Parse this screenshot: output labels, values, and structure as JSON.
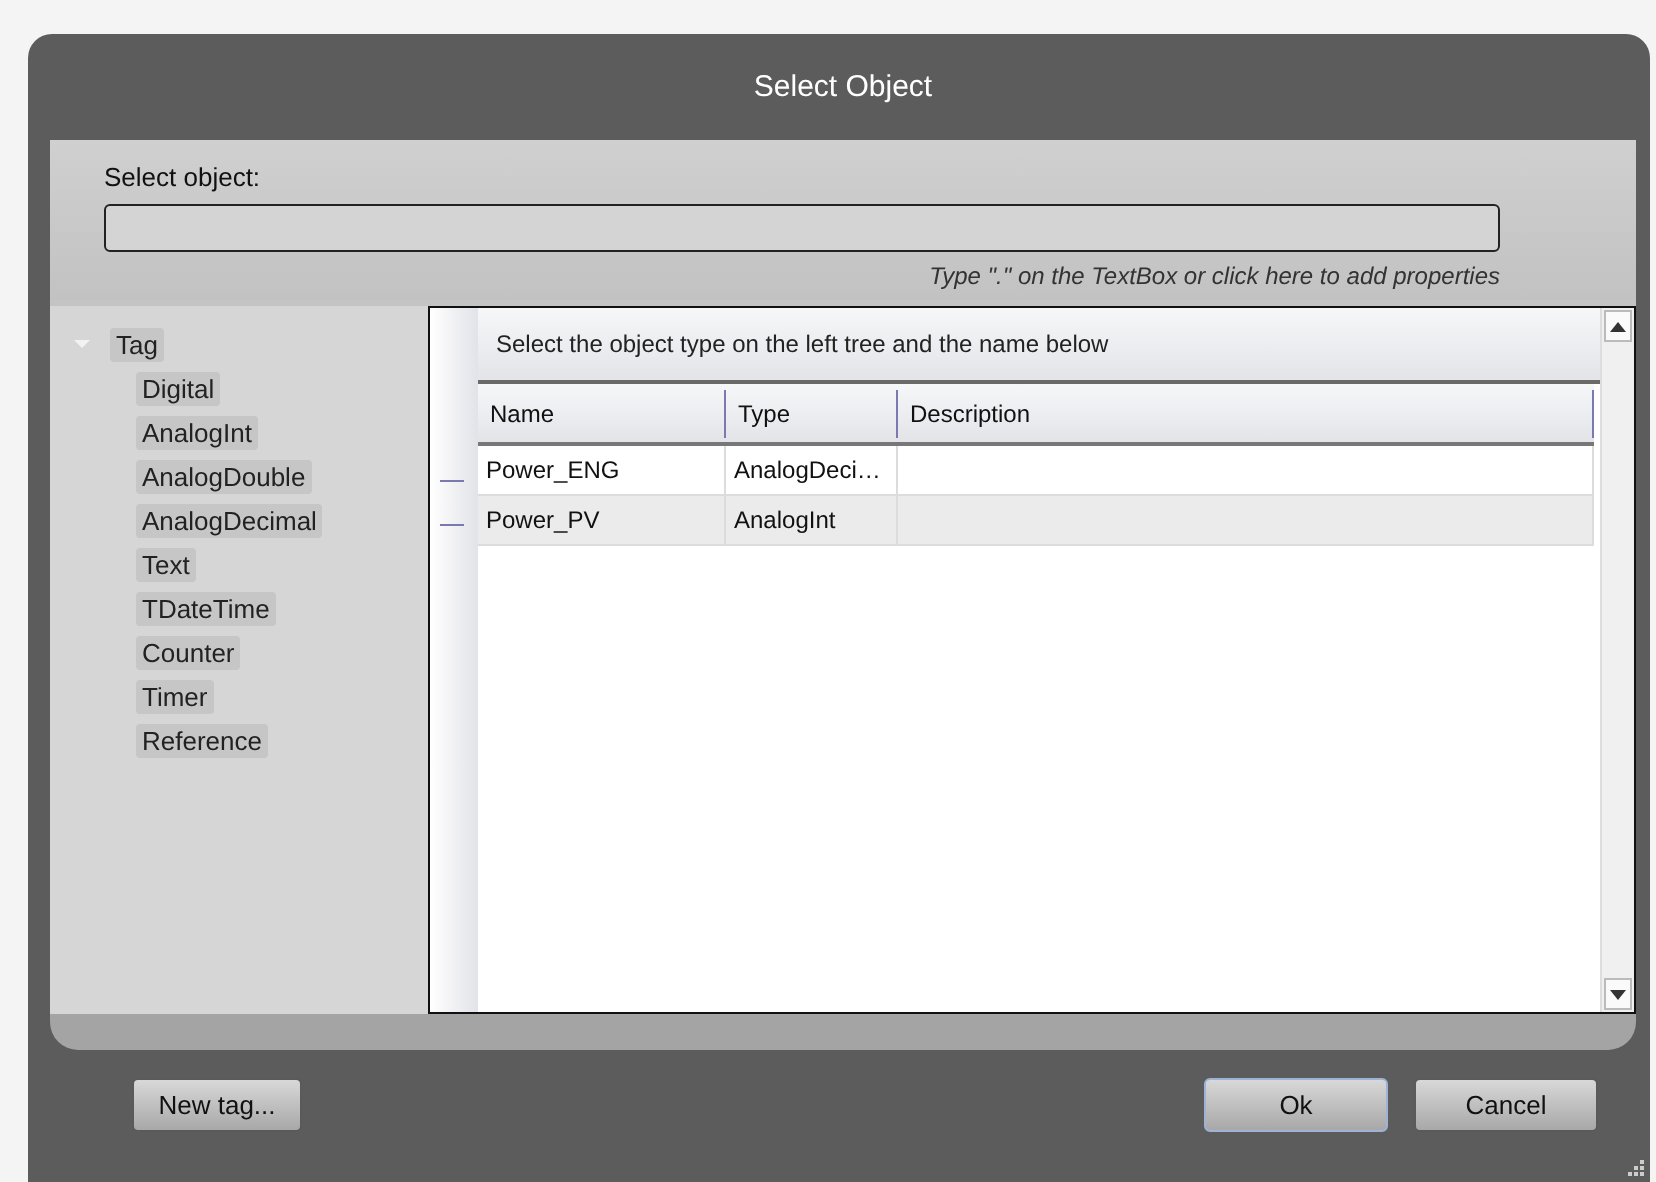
{
  "window": {
    "title": "Select Object"
  },
  "select_field": {
    "label": "Select object:",
    "hint": "Type \".\" on the TextBox or click here to add properties"
  },
  "tree": [
    {
      "label": "Tag",
      "expanded": true,
      "children": [
        {
          "label": "Digital"
        },
        {
          "label": "AnalogInt"
        },
        {
          "label": "AnalogDouble"
        },
        {
          "label": "AnalogDecimal"
        },
        {
          "label": "Text"
        },
        {
          "label": "TDateTime"
        },
        {
          "label": "Counter"
        },
        {
          "label": "Timer"
        },
        {
          "label": "Reference"
        }
      ]
    }
  ],
  "table": {
    "caption": "Select the object type on the left tree and the name below",
    "columns": [
      "Name",
      "Type",
      "Description"
    ],
    "rows": [
      {
        "name": "Power_ENG",
        "type": "AnalogDeci…"
      },
      {
        "name": "Power_PV",
        "type": "AnalogInt"
      }
    ]
  },
  "left_buttons": [
    {
      "label": "New tag...",
      "focused": false
    }
  ],
  "right_buttons": [
    {
      "label": "Ok",
      "focused": true
    },
    {
      "label": "Cancel",
      "focused": false
    }
  ]
}
